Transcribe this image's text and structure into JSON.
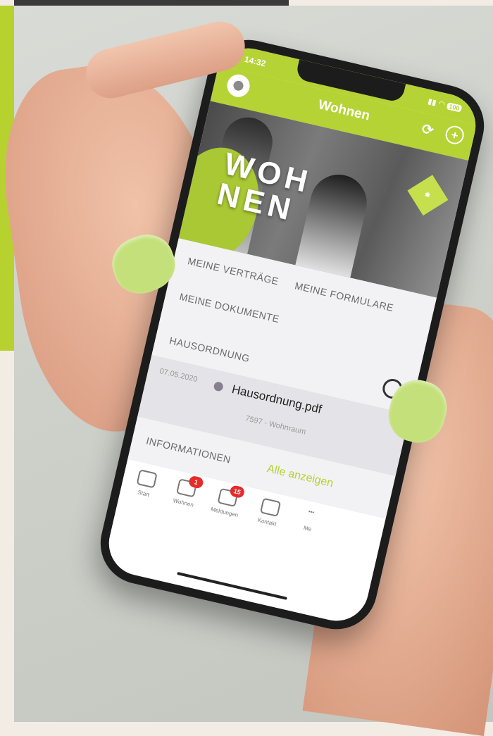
{
  "phone": {
    "status": {
      "time": "14:32",
      "battery": "100"
    },
    "header": {
      "title": "Wohnen"
    },
    "hero": {
      "title": "WOH\nNEN"
    },
    "sub_nav": {
      "contracts": "MEINE VERTRÄGE",
      "forms": "MEINE FORMULARE",
      "documents": "MEINE DOKUMENTE"
    },
    "house_rules": {
      "title": "HAUSORDNUNG",
      "document": {
        "date": "07.05.2020",
        "name": "Hausordnung.pdf",
        "meta": "7597 - Wohnraum"
      }
    },
    "information": {
      "title": "INFORMATIONEN",
      "show_all": "Alle anzeigen"
    },
    "tabs": [
      {
        "label": "Start",
        "icon": "home-icon"
      },
      {
        "label": "Wohnen",
        "icon": "wohnen-icon",
        "badge": "1"
      },
      {
        "label": "Meldungen",
        "icon": "mail-icon",
        "badge": "15"
      },
      {
        "label": "Kontakt",
        "icon": "contact-icon"
      },
      {
        "label": "Me",
        "icon": "more-icon"
      }
    ]
  },
  "colors": {
    "accent": "#b5d334",
    "badge": "#e62b2b",
    "nail": "#c4e07a"
  }
}
